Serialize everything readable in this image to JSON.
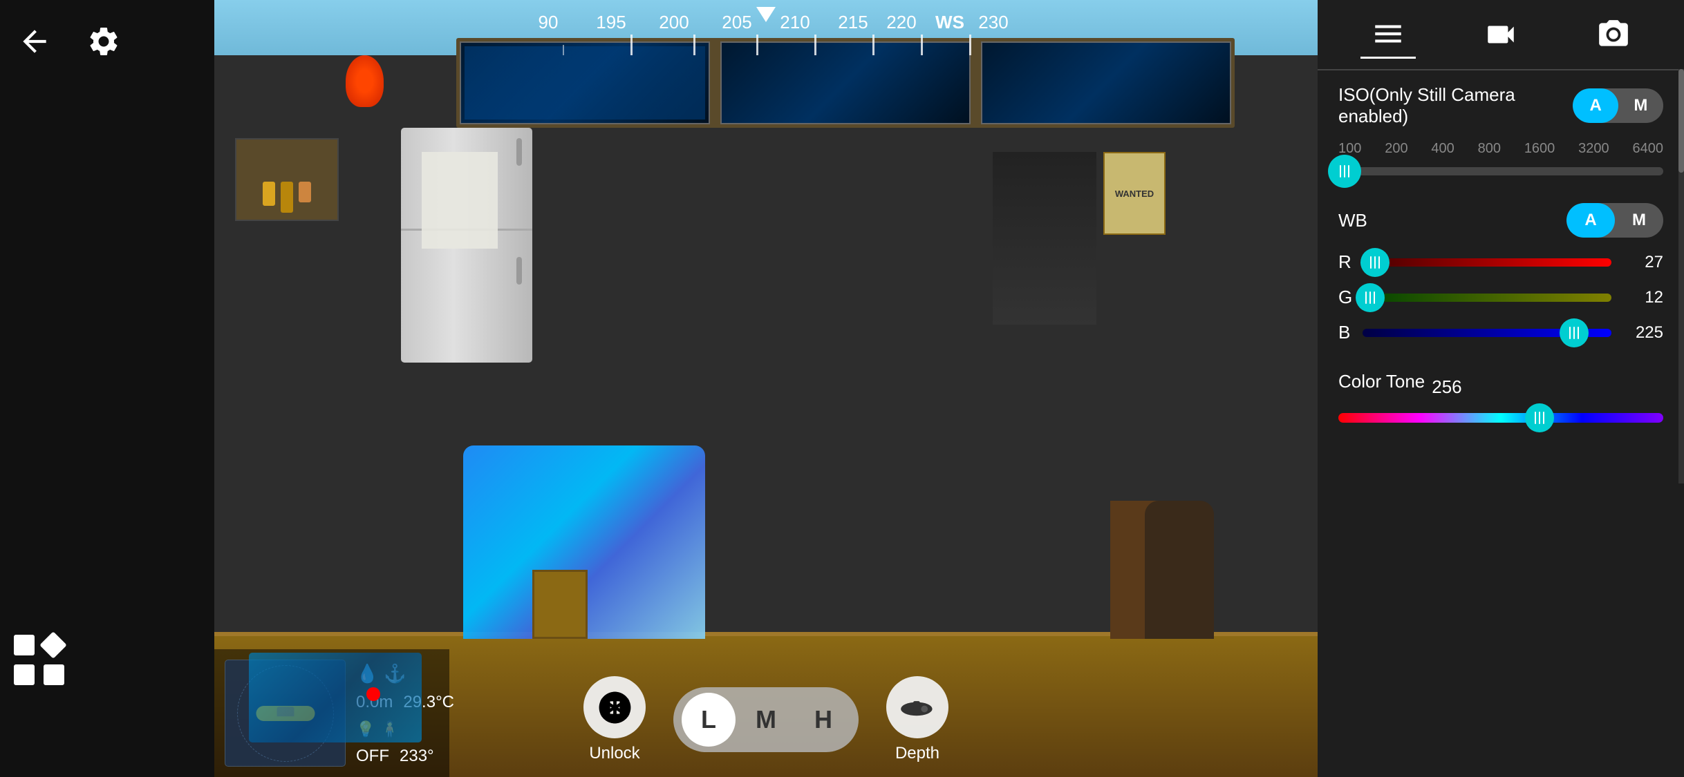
{
  "leftSidebar": {
    "backLabel": "back",
    "settingsLabel": "settings",
    "layoutLabel": "layout"
  },
  "compass": {
    "values": [
      "90",
      "195",
      "200",
      "205",
      "210",
      "215",
      "220",
      "WS",
      "230"
    ],
    "currentHeading": "WS"
  },
  "telemetry": {
    "depth": "0.0m",
    "temperature": "29.3°C",
    "light": "OFF",
    "heading": "233°"
  },
  "bottomControls": {
    "unlockLabel": "Unlock",
    "speedOptions": [
      "L",
      "M",
      "H"
    ],
    "activeSpeed": "L",
    "depthLabel": "Depth"
  },
  "rightPanel": {
    "tabs": [
      "settings",
      "video",
      "camera"
    ],
    "activeTab": "settings",
    "iso": {
      "label": "ISO(Only Still Camera enabled)",
      "mode": "A",
      "modeOptions": [
        "A",
        "M"
      ],
      "scaleValues": [
        "100",
        "200",
        "400",
        "800",
        "1600",
        "3200",
        "6400"
      ],
      "thumbPosition": 0
    },
    "wb": {
      "label": "WB",
      "mode": "A",
      "modeOptions": [
        "A",
        "M"
      ],
      "R": {
        "label": "R",
        "value": 27,
        "thumbPosition": 5
      },
      "G": {
        "label": "G",
        "value": 12,
        "thumbPosition": 4
      },
      "B": {
        "label": "B",
        "value": 225,
        "thumbPosition": 88
      }
    },
    "colorTone": {
      "label": "Color Tone",
      "value": 256,
      "thumbPosition": 65
    }
  }
}
